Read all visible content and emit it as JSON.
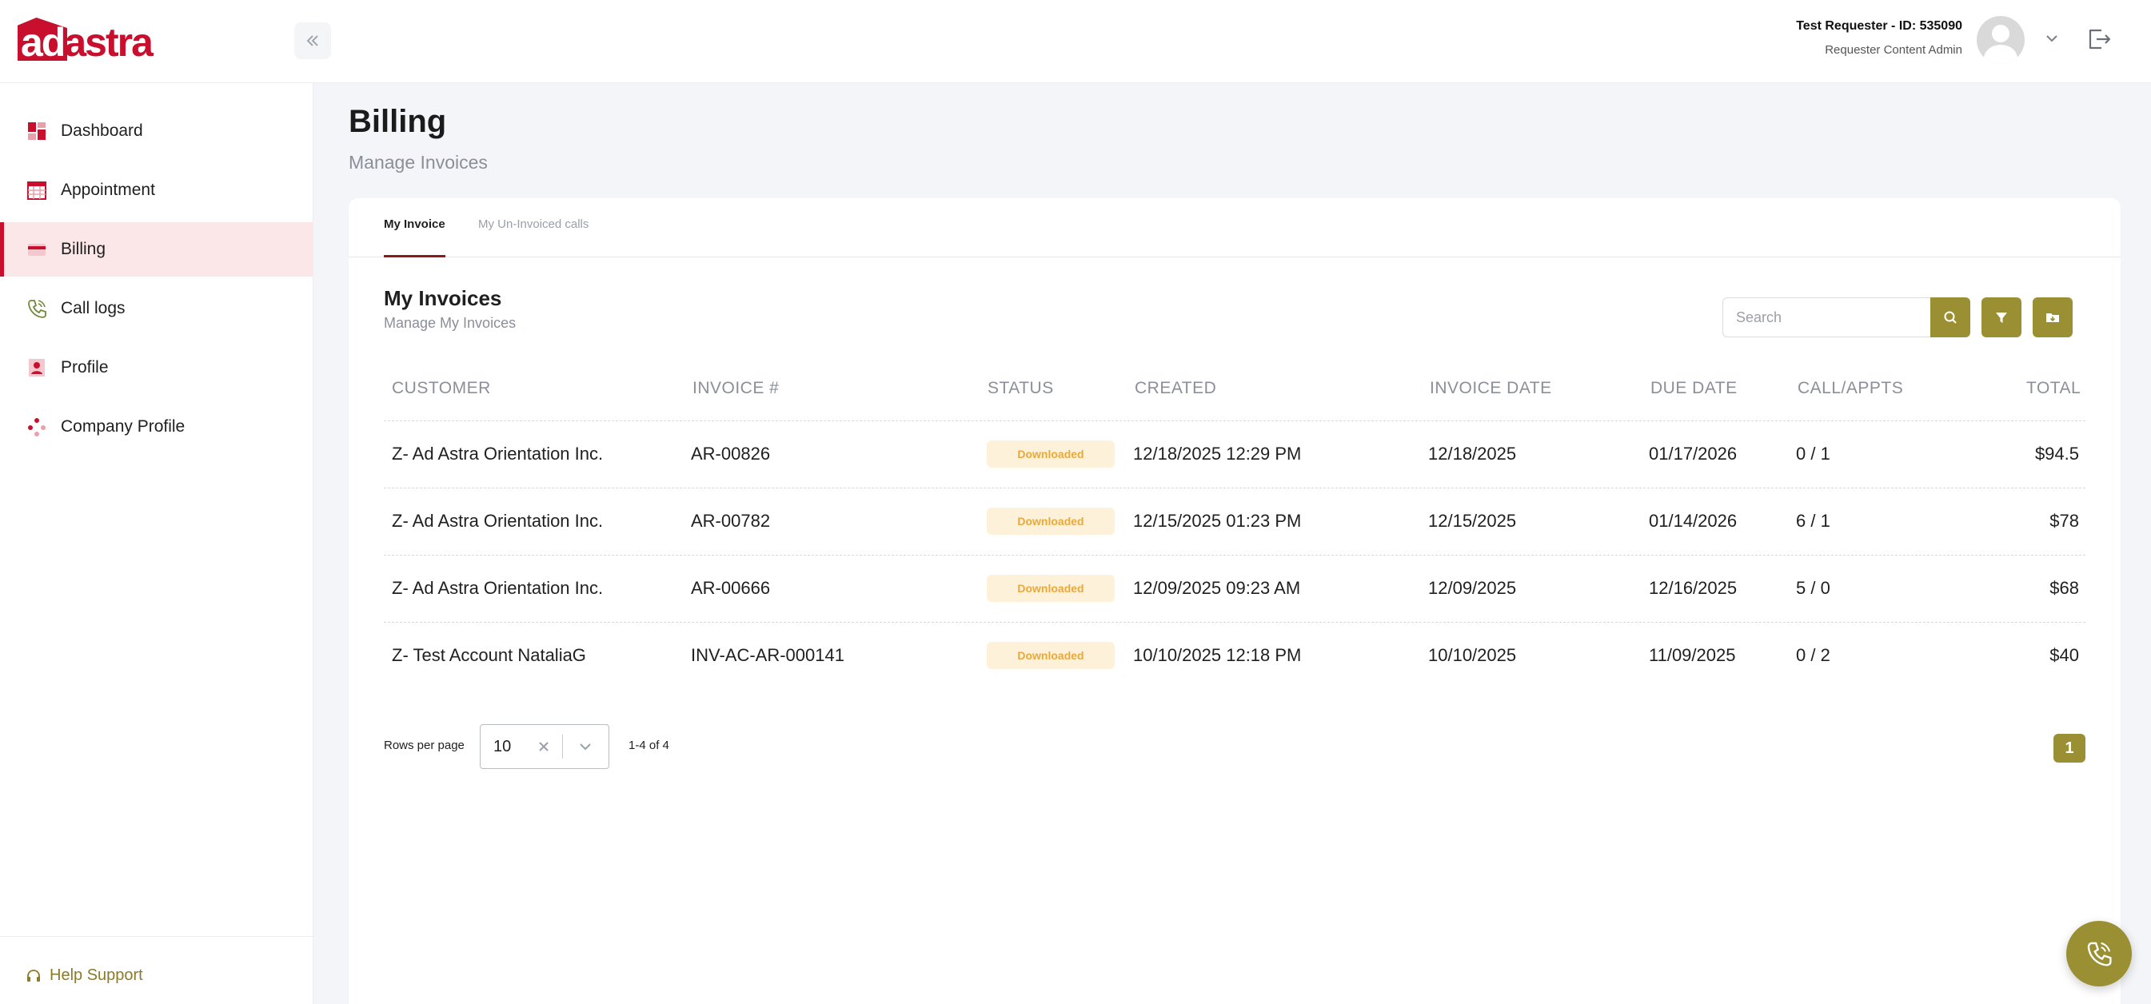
{
  "brand": {
    "logo_ad": "ad",
    "logo_astra": "astra",
    "primary_color": "#c8102e",
    "accent_color": "#9a9033"
  },
  "header": {
    "user_name": "Test Requester - ID: 535090",
    "user_role": "Requester Content Admin",
    "collapse_icon": "double-chevron-left-icon",
    "logout_icon": "logout-icon"
  },
  "sidebar": {
    "items": [
      {
        "label": "Dashboard",
        "icon": "dashboard-icon"
      },
      {
        "label": "Appointment",
        "icon": "calendar-icon"
      },
      {
        "label": "Billing",
        "icon": "credit-card-icon",
        "active": true
      },
      {
        "label": "Call logs",
        "icon": "phone-icon"
      },
      {
        "label": "Profile",
        "icon": "profile-card-icon"
      },
      {
        "label": "Company Profile",
        "icon": "company-icon"
      }
    ],
    "help_label": "Help Support"
  },
  "page": {
    "title": "Billing",
    "subtitle": "Manage Invoices"
  },
  "tabs": [
    {
      "label": "My Invoice",
      "active": true
    },
    {
      "label": "My Un-Invoiced calls",
      "active": false
    }
  ],
  "invoices": {
    "title": "My Invoices",
    "subtitle": "Manage My Invoices",
    "search_placeholder": "Search",
    "columns": [
      "CUSTOMER",
      "INVOICE #",
      "STATUS",
      "CREATED",
      "INVOICE DATE",
      "DUE DATE",
      "CALL/APPTS",
      "TOTAL"
    ],
    "rows": [
      {
        "customer": "Z- Ad Astra Orientation Inc.",
        "invoice": "AR-00826",
        "status": "Downloaded",
        "created": "12/18/2025 12:29 PM",
        "invoice_date": "12/18/2025",
        "due_date": "01/17/2026",
        "calls": "0 / 1",
        "total": "$94.5"
      },
      {
        "customer": "Z- Ad Astra Orientation Inc.",
        "invoice": "AR-00782",
        "status": "Downloaded",
        "created": "12/15/2025 01:23 PM",
        "invoice_date": "12/15/2025",
        "due_date": "01/14/2026",
        "calls": "6 / 1",
        "total": "$78"
      },
      {
        "customer": "Z- Ad Astra Orientation Inc.",
        "invoice": "AR-00666",
        "status": "Downloaded",
        "created": "12/09/2025 09:23 AM",
        "invoice_date": "12/09/2025",
        "due_date": "12/16/2025",
        "calls": "5 / 0",
        "total": "$68"
      },
      {
        "customer": "Z- Test Account NataliaG",
        "invoice": "INV-AC-AR-000141",
        "status": "Downloaded",
        "created": "10/10/2025 12:18 PM",
        "invoice_date": "10/10/2025",
        "due_date": "11/09/2025",
        "calls": "0 / 2",
        "total": "$40"
      }
    ]
  },
  "pagination": {
    "rows_per_page_label": "Rows per page",
    "rows_per_page_value": "10",
    "range": "1-4 of 4",
    "current_page": "1"
  }
}
